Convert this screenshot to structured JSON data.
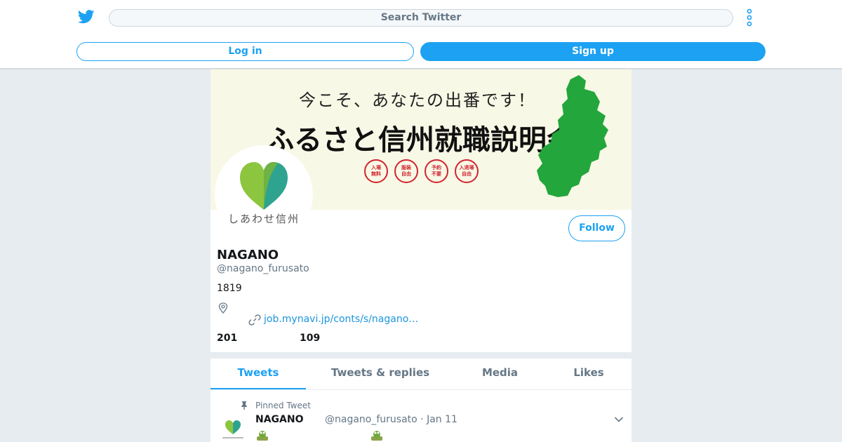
{
  "header": {
    "search_placeholder": "Search Twitter",
    "login_label": "Log in",
    "signup_label": "Sign up"
  },
  "banner": {
    "line1": "今こそ、あなたの出番です！",
    "line2": "ふるさと信州就職説明会",
    "badges": [
      [
        "入場",
        "無料"
      ],
      [
        "服装",
        "自由"
      ],
      [
        "予約",
        "不要"
      ],
      [
        "入退場",
        "自由"
      ]
    ]
  },
  "avatar": {
    "caption": "しあわせ信州"
  },
  "profile": {
    "follow_label": "Follow",
    "display_name": "NAGANO",
    "handle": "@nagano_furusato",
    "bio": "1819",
    "url": "job.mynavi.jp/conts/s/nagano…",
    "following_count": "201",
    "followers_count": "109"
  },
  "tabs": [
    {
      "label": "Tweets",
      "active": true
    },
    {
      "label": "Tweets & replies",
      "active": false
    },
    {
      "label": "Media",
      "active": false
    },
    {
      "label": "Likes",
      "active": false
    }
  ],
  "tweet": {
    "pinned_label": "Pinned Tweet",
    "name": "NAGANO",
    "handle_date": "@nagano_furusato · Jan 11"
  },
  "icons": {
    "logo": "twitter-bird-icon",
    "more": "vertical-dots-icon",
    "location": "map-pin-icon",
    "link": "link-icon",
    "pin": "pushpin-icon",
    "caret": "chevron-down-icon"
  },
  "colors": {
    "accent": "#1da1f2",
    "link": "#1b95e0",
    "background": "#e6ecf0",
    "secondary_text": "#657786",
    "badge_red": "#d1242f",
    "map_green": "#23a63c",
    "banner_bg": "#f8f8e6"
  }
}
